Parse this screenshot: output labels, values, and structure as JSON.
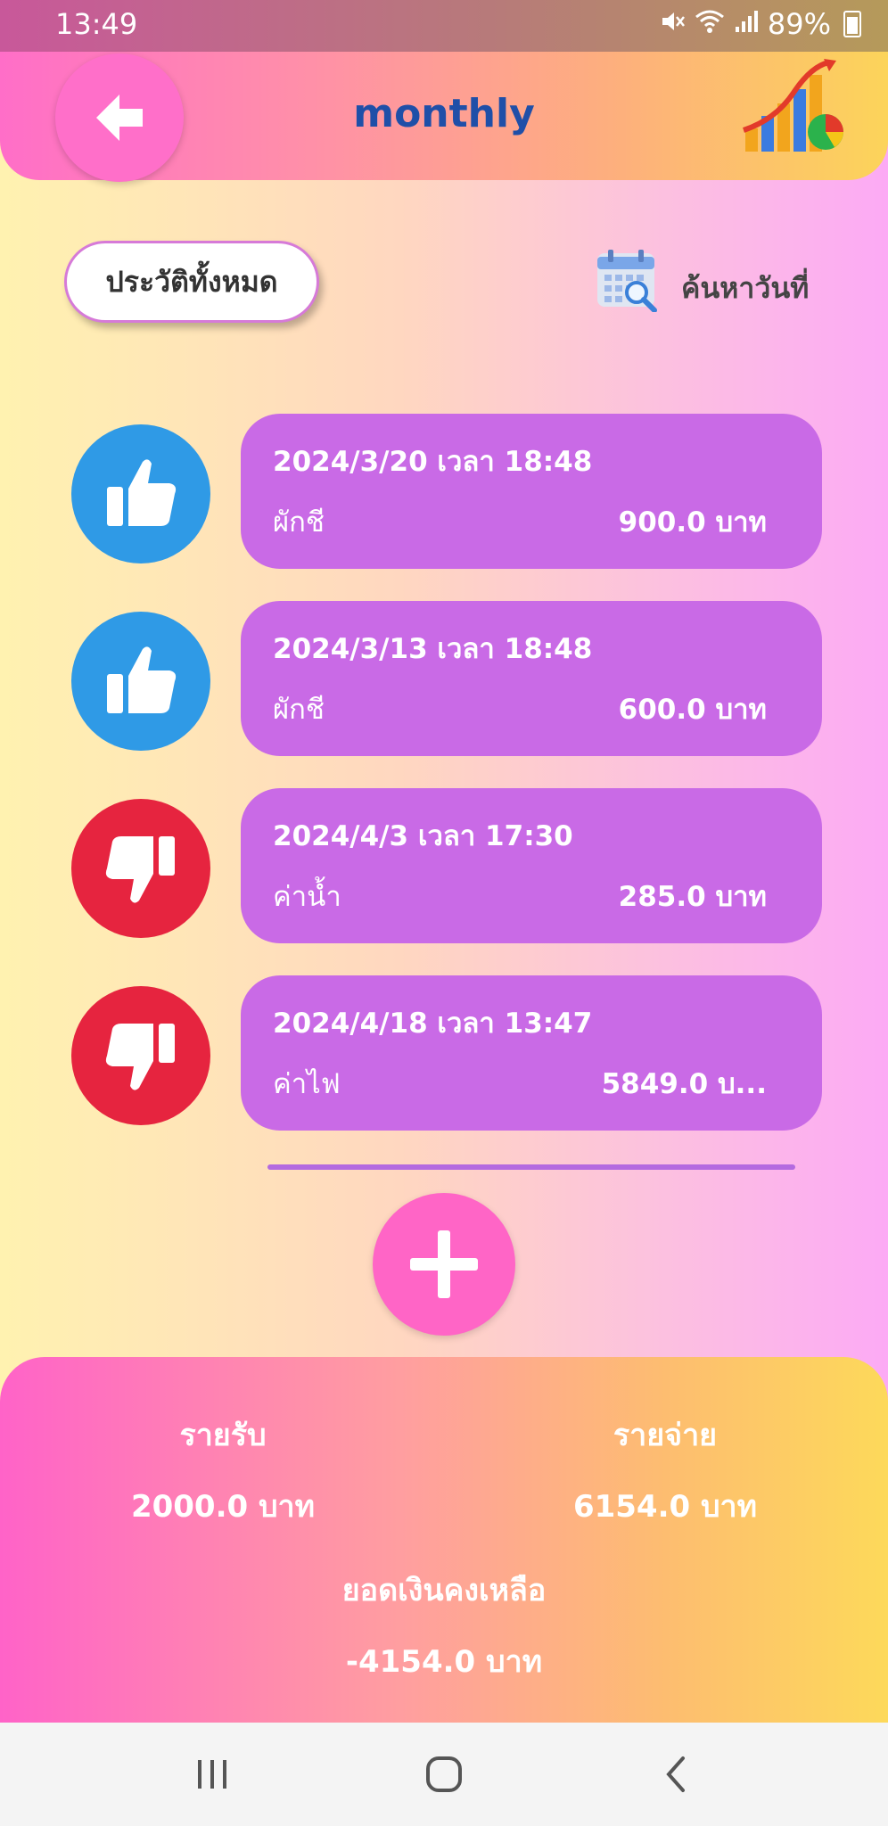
{
  "status_bar": {
    "time": "13:49",
    "battery": "89%",
    "icons": [
      "mute-icon",
      "wifi-icon",
      "signal-icon",
      "battery-icon"
    ]
  },
  "header": {
    "title": "monthly",
    "back_icon": "arrow-left-icon",
    "logo_icon": "bar-chart-logo-icon"
  },
  "controls": {
    "history_label": "ประวัติทั้งหมด",
    "search_date_label": "ค้นหาวันที่",
    "calendar_icon": "calendar-search-icon"
  },
  "transactions": [
    {
      "type": "income",
      "icon": "thumbs-up-icon",
      "datetime": "2024/3/20 เวลา 18:48",
      "category": "ผักชี",
      "amount": "900.0 บาท"
    },
    {
      "type": "income",
      "icon": "thumbs-up-icon",
      "datetime": "2024/3/13 เวลา 18:48",
      "category": "ผักชี",
      "amount": "600.0 บาท"
    },
    {
      "type": "expense",
      "icon": "thumbs-down-icon",
      "datetime": "2024/4/3 เวลา 17:30",
      "category": "ค่าน้ำ",
      "amount": "285.0 บาท"
    },
    {
      "type": "expense",
      "icon": "thumbs-down-icon",
      "datetime": "2024/4/18 เวลา 13:47",
      "category": "ค่าไฟ",
      "amount": "5849.0 บ..."
    }
  ],
  "add_button_icon": "plus-icon",
  "summary": {
    "income_label": "รายรับ",
    "income_value": "2000.0 บาท",
    "expense_label": "รายจ่าย",
    "expense_value": "6154.0 บาท",
    "balance_label": "ยอดเงินคงเหลือ",
    "balance_value": "-4154.0 บาท"
  },
  "navbar": {
    "icons": [
      "recent-apps-icon",
      "home-icon",
      "back-nav-icon"
    ]
  },
  "colors": {
    "card": "#c96ae6",
    "income_icon_bg": "#2f9ae6",
    "expense_icon_bg": "#e6243f",
    "title": "#1f4fa8",
    "accent_pink": "#ff65c6"
  }
}
